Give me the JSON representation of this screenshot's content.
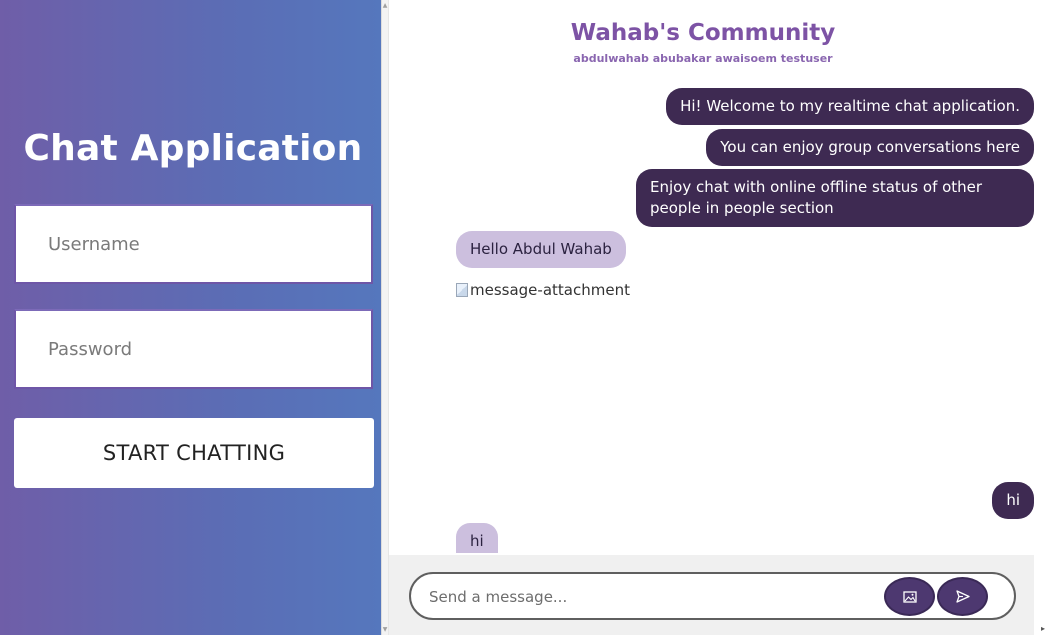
{
  "login": {
    "title": "Chat Application",
    "username_placeholder": "Username",
    "password_placeholder": "Password",
    "start_button": "START CHATTING"
  },
  "chat": {
    "community_title": "Wahab's Community",
    "members": "abdulwahab abubakar awaisoem testuser",
    "messages": [
      {
        "text": "Hi! Welcome to my realtime chat application.",
        "sender": "me"
      },
      {
        "text": "You can enjoy group conversations here",
        "sender": "me"
      },
      {
        "text": "Enjoy chat with online offline status of other people in people section",
        "sender": "me"
      },
      {
        "text": "Hello Abdul Wahab",
        "sender": "other"
      },
      {
        "text": "message-attachment",
        "sender": "other",
        "type": "attachment"
      },
      {
        "text": "hi",
        "sender": "me"
      },
      {
        "text": "hi",
        "sender": "other"
      }
    ],
    "composer_placeholder": "Send a message..."
  },
  "colors": {
    "panel_gradient_start": "#6f5ea8",
    "panel_gradient_end": "#5577bd",
    "my_bubble": "#3e2a52",
    "their_bubble": "#ccbfde",
    "title": "#7d53a5",
    "action_button": "#4d3870"
  },
  "icons": {
    "image_button": "image-icon",
    "send_button": "send-icon"
  }
}
